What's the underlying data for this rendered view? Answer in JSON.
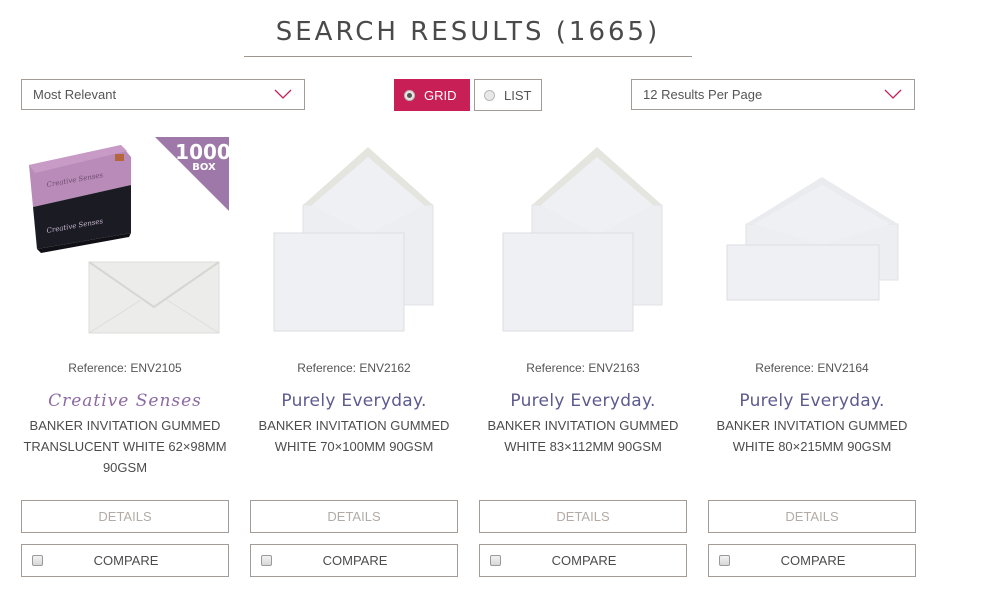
{
  "header": {
    "title": "SEARCH RESULTS (1665)"
  },
  "toolbar": {
    "sort": {
      "selected": "Most Relevant"
    },
    "view": {
      "grid_label": "GRID",
      "list_label": "LIST",
      "selected": "grid"
    },
    "per_page": {
      "selected": "12 Results Per Page"
    }
  },
  "colors": {
    "accent": "#c71f56",
    "border": "#a39b95",
    "brand_purely": "#5c5a8f",
    "brand_creative": "#8c6aa3",
    "badge": "#9d78a8"
  },
  "products": [
    {
      "reference": "Reference: ENV2105",
      "brand": "Creative Senses",
      "brand_style": "script",
      "name": "BANKER INVITATION GUMMED TRANSLUCENT WHITE 62×98MM 90GSM",
      "badge": {
        "number": "1000",
        "unit": "BOX"
      },
      "box_label": "Creative Senses",
      "details_label": "DETAILS",
      "compare_label": "COMPARE"
    },
    {
      "reference": "Reference: ENV2162",
      "brand": "Purely Everyday.",
      "brand_style": "plain",
      "name": "BANKER INVITATION GUMMED WHITE 70×100MM 90GSM",
      "details_label": "DETAILS",
      "compare_label": "COMPARE"
    },
    {
      "reference": "Reference: ENV2163",
      "brand": "Purely Everyday.",
      "brand_style": "plain",
      "name": "BANKER INVITATION GUMMED WHITE 83×112MM 90GSM",
      "details_label": "DETAILS",
      "compare_label": "COMPARE"
    },
    {
      "reference": "Reference: ENV2164",
      "brand": "Purely Everyday.",
      "brand_style": "plain",
      "name": "BANKER INVITATION GUMMED WHITE 80×215MM 90GSM",
      "details_label": "DETAILS",
      "compare_label": "COMPARE"
    }
  ]
}
